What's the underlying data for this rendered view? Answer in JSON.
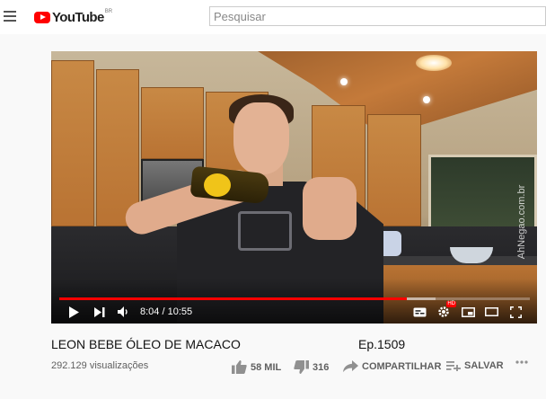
{
  "masthead": {
    "logo_text": "YouTube",
    "region": "BR",
    "search_placeholder": "Pesquisar"
  },
  "player": {
    "current_time": "8:04",
    "duration": "10:55",
    "time_separator": " / ",
    "progress_fraction": 0.738,
    "buffered_fraction": 0.8,
    "watermark": "AhNegao.com.br",
    "accent_color": "#ff0000"
  },
  "video": {
    "title": "LEON BEBE ÓLEO DE MACACO",
    "episode": "Ep.1509",
    "views": "292.129 visualizações"
  },
  "actions": {
    "likes": "58 MIL",
    "dislikes": "316",
    "share": "COMPARTILHAR",
    "save": "SALVAR"
  },
  "icons": {
    "menu": "hamburger-icon",
    "play": "play-icon",
    "next": "skip-next-icon",
    "volume": "volume-icon",
    "subtitles": "subtitles-icon",
    "settings": "gear-icon",
    "miniplayer": "miniplayer-icon",
    "theater": "theater-mode-icon",
    "fullscreen": "fullscreen-icon",
    "like": "thumbs-up-icon",
    "dislike": "thumbs-down-icon",
    "share": "share-arrow-icon",
    "save": "playlist-add-icon",
    "more": "more-horizontal-icon"
  }
}
